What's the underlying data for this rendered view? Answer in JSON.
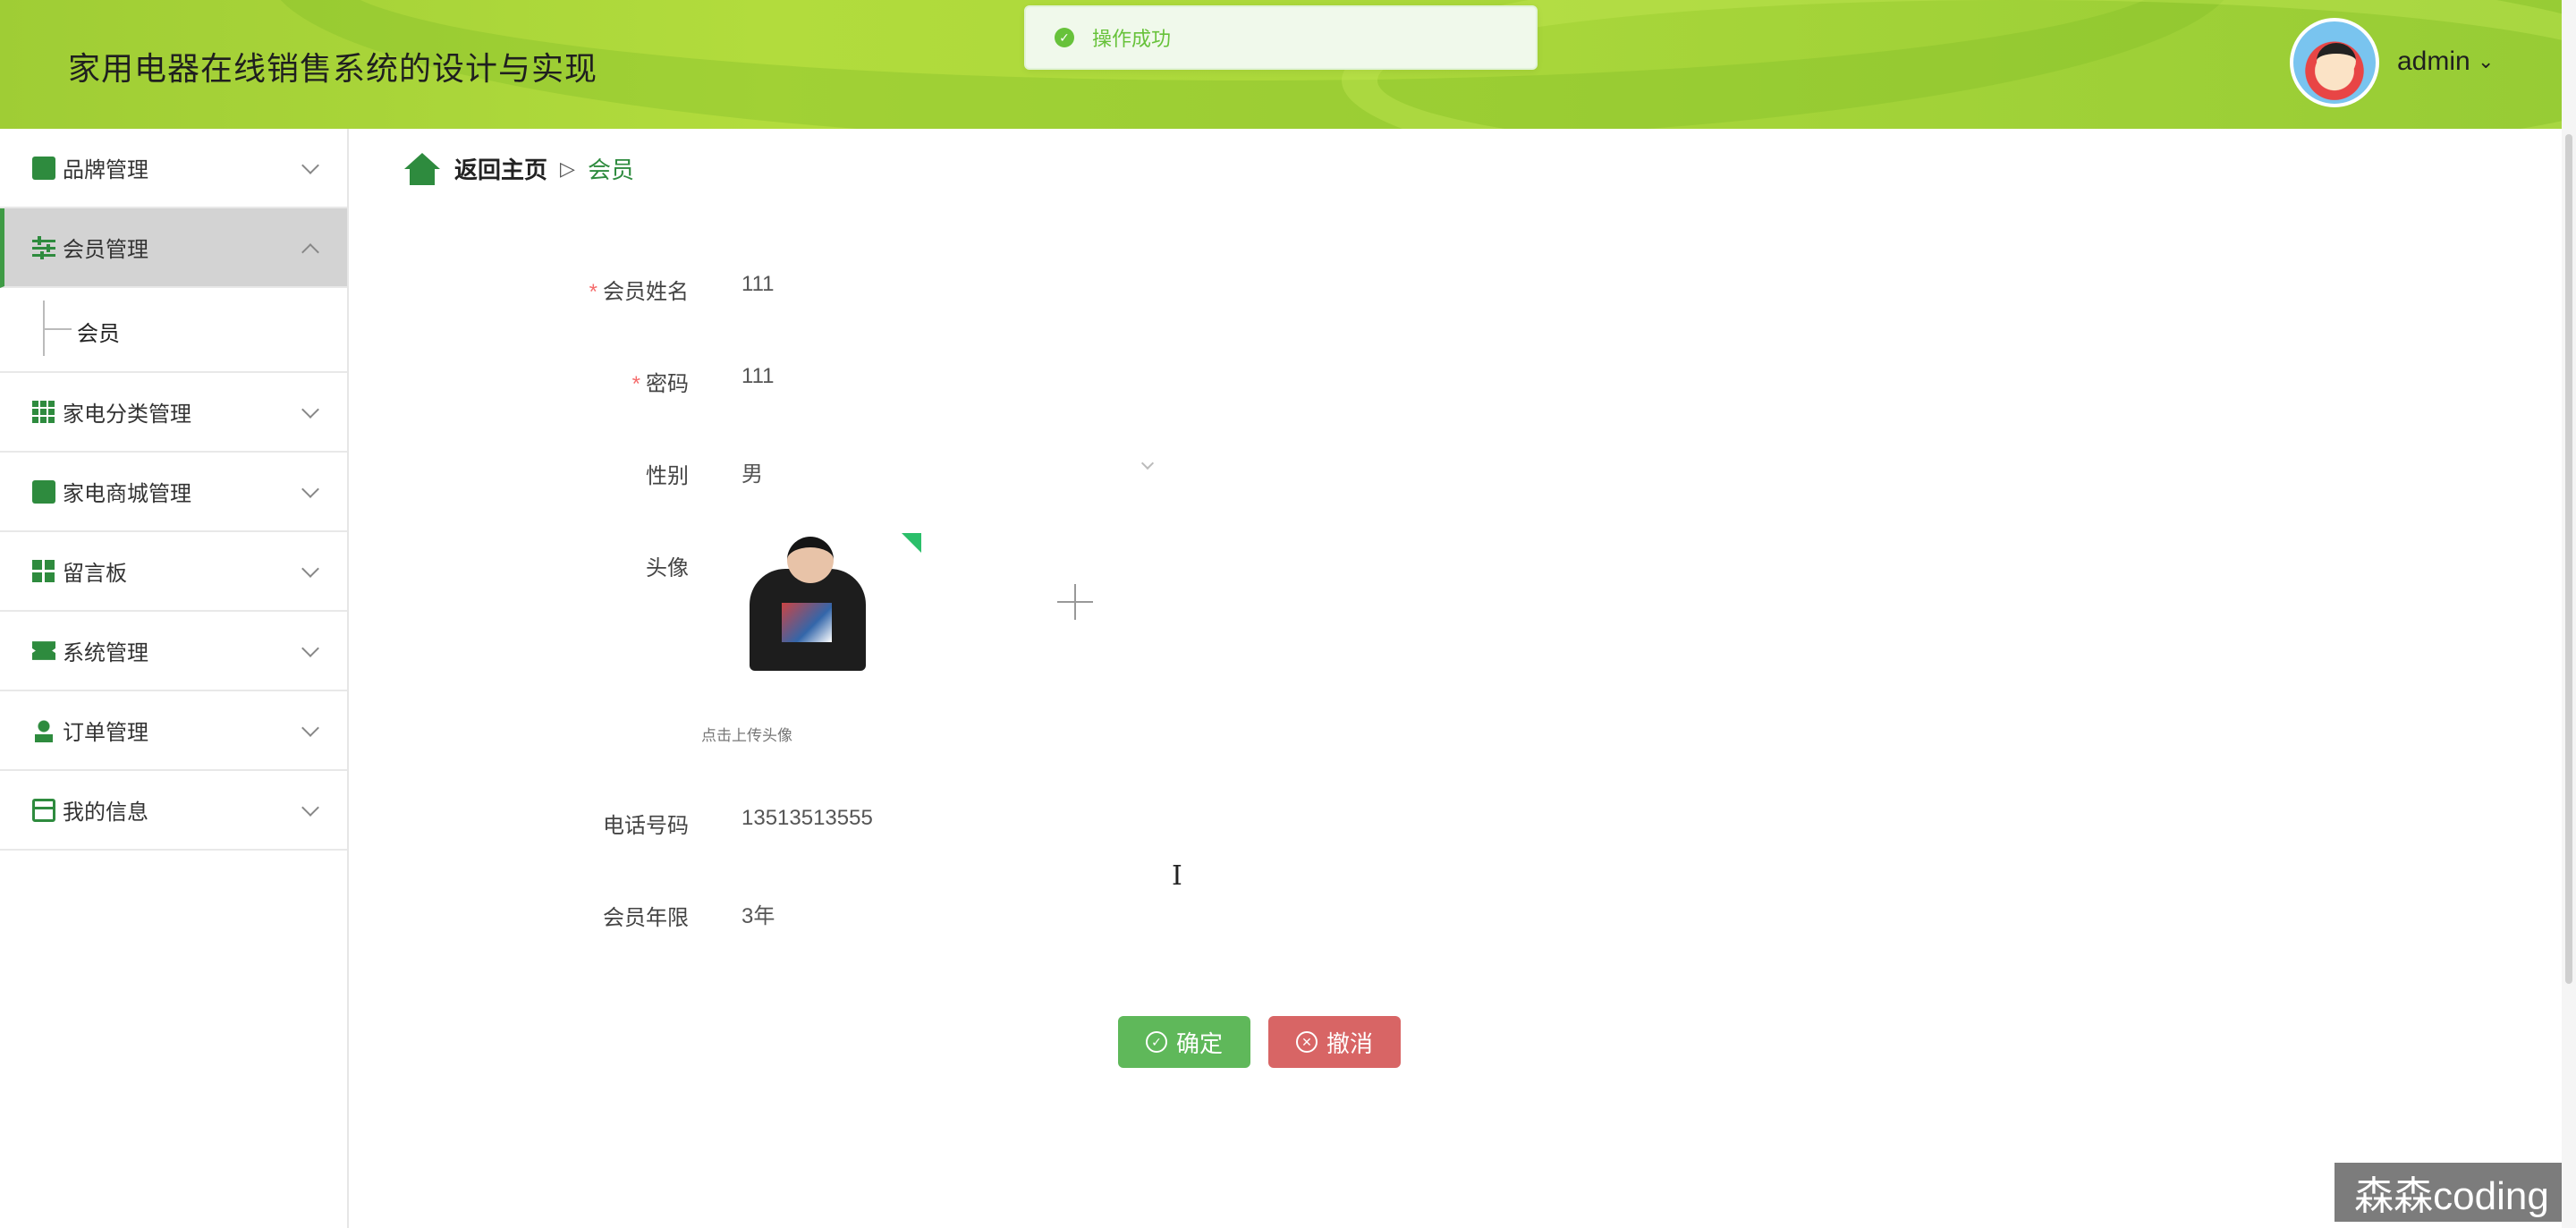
{
  "header": {
    "title": "家用电器在线销售系统的设计与实现",
    "username": "admin",
    "caret": "⌄"
  },
  "toast": {
    "icon": "✓",
    "message": "操作成功",
    "color": "#67c23a"
  },
  "sidebar": {
    "items": [
      {
        "label": "品牌管理",
        "icon": "brand-icon"
      },
      {
        "label": "会员管理",
        "icon": "sliders-icon",
        "expanded": true
      },
      {
        "label": "家电分类管理",
        "icon": "grid-icon"
      },
      {
        "label": "家电商城管理",
        "icon": "clipboard-icon"
      },
      {
        "label": "留言板",
        "icon": "dashboard-icon"
      },
      {
        "label": "系统管理",
        "icon": "ticket-icon"
      },
      {
        "label": "订单管理",
        "icon": "user-icon"
      },
      {
        "label": "我的信息",
        "icon": "card-icon"
      }
    ],
    "subitems": [
      {
        "label": "会员"
      }
    ]
  },
  "breadcrumb": {
    "home": "返回主页",
    "separator": "▷",
    "current": "会员"
  },
  "form": {
    "name_label": "会员姓名",
    "name_value": "111",
    "password_label": "密码",
    "password_value": "111",
    "gender_label": "性别",
    "gender_value": "男",
    "avatar_label": "头像",
    "upload_hint": "点击上传头像",
    "phone_label": "电话号码",
    "phone_value": "13513513555",
    "years_label": "会员年限",
    "years_value": "3年",
    "required_mark": "*"
  },
  "buttons": {
    "confirm": "确定",
    "confirm_icon": "✓",
    "cancel": "撤消",
    "cancel_icon": "✕"
  },
  "cursor": "I",
  "watermark": "森森coding",
  "colors": {
    "accent": "#2e8b3e",
    "header": "#a8d63a",
    "confirm": "#5fb85a",
    "cancel": "#d86565",
    "required": "#f56c6c"
  }
}
